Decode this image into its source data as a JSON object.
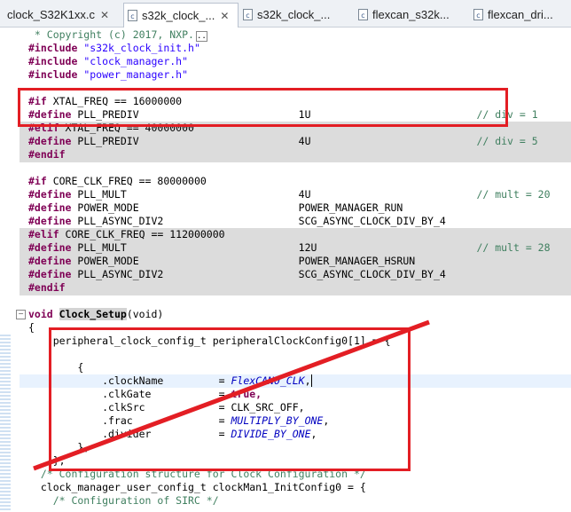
{
  "tabs": [
    {
      "label": "clock_S32K1xx.c",
      "icon": "c-file-icon",
      "active": false
    },
    {
      "label": "s32k_clock_...",
      "icon": "c-file-icon",
      "active": true
    },
    {
      "label": "s32k_clock_...",
      "icon": "c-file-icon",
      "active": false
    },
    {
      "label": "flexcan_s32k...",
      "icon": "c-file-icon",
      "active": false
    },
    {
      "label": "flexcan_dri...",
      "icon": "c-file-icon",
      "active": false
    }
  ],
  "close_glyph": "✕",
  "code": {
    "copyright": " * Copyright (c) 2017, NXP.",
    "inc1_kw": "#include",
    "inc1_str": "\"s32k_clock_init.h\"",
    "inc2_kw": "#include",
    "inc2_str": "\"clock_manager.h\"",
    "inc3_kw": "#include",
    "inc3_str": "\"power_manager.h\"",
    "if1": "#if",
    "if1_rest": " XTAL_FREQ == 16000000",
    "def1": "#define",
    "def1_rest": " PLL_PREDIV                          1U                           ",
    "def1_cm": "// div = 1",
    "elif1": "#elif",
    "elif1_rest": " XTAL_FREQ == 40000000",
    "def2": "#define",
    "def2_rest": " PLL_PREDIV                          4U                           ",
    "def2_cm": "// div = 5",
    "endif1": "#endif",
    "if2": "#if",
    "if2_rest": " CORE_CLK_FREQ == 80000000",
    "def3": "#define",
    "def3_rest": " PLL_MULT                            4U                           ",
    "def3_cm": "// mult = 20",
    "def4": "#define",
    "def4_rest": " POWER_MODE                          POWER_MANAGER_RUN",
    "def5": "#define",
    "def5_rest": " PLL_ASYNC_DIV2                      SCG_ASYNC_CLOCK_DIV_BY_4",
    "elif2": "#elif",
    "elif2_rest": " CORE_CLK_FREQ == 112000000",
    "def6": "#define",
    "def6_rest": " PLL_MULT                            12U                          ",
    "def6_cm": "// mult = 28",
    "def7": "#define",
    "def7_rest": " POWER_MODE                          POWER_MANAGER_HSRUN",
    "def8": "#define",
    "def8_rest": " PLL_ASYNC_DIV2                      SCG_ASYNC_CLOCK_DIV_BY_4",
    "endif2": "#endif",
    "fn_void": "void",
    "fn_name": "Clock_Setup",
    "fn_args": "(void)",
    "brace_open": "{",
    "periph_decl": "    peripheral_clock_config_t peripheralClockConfig0[1] = {",
    "inner_open": "        {",
    "f1_name": "            .clockName         = ",
    "f1_val": "FlexCAN0_CLK",
    "f1_end": ",",
    "f2_name": "            .clkGate           = ",
    "f2_val": "true,",
    "f3_name": "            .clkSrc            = ",
    "f3_val": "CLK_SRC_OFF,",
    "f4_name": "            .frac              = ",
    "f4_val": "MULTIPLY_BY_ONE",
    "f4_end": ",",
    "f5_name": "            .divider           = ",
    "f5_val": "DIVIDE_BY_ONE",
    "f5_end": ",",
    "inner_close": "        },",
    "outer_close": "    };",
    "cm_config": "  /* Configuration structure for Clock Configuration */",
    "man_decl": "  clock_manager_user_config_t clockMan1_InitConfig0 = {",
    "cm_sirc": "    /* Configuration of SIRC */"
  },
  "annotation_color": "#e31e24"
}
